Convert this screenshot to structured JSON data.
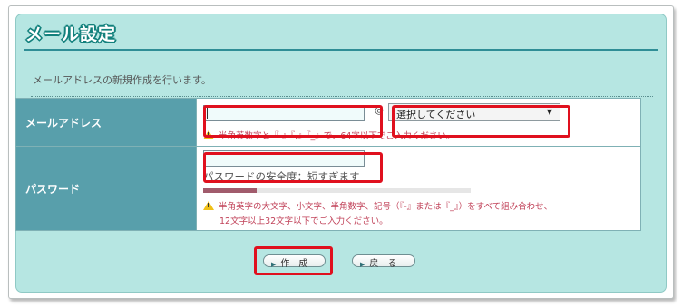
{
  "panel": {
    "title": "メール設定",
    "description": "メールアドレスの新規作成を行います。"
  },
  "form": {
    "email": {
      "label": "メールアドレス",
      "local_part_value": "",
      "at_sign": "@",
      "domain_select": {
        "selected": "選択してください"
      },
      "hint": "半角英数字と『-』『.』『_』で、64字以下でご入力ください。"
    },
    "password": {
      "label": "パスワード",
      "value": "",
      "strength_text": "パスワードの安全度：短すぎます",
      "strength_level": 0.2,
      "hint_line1": "半角英字の大文字、小文字、半角数字、記号（『-』または『_』）をすべて組み合わせ、",
      "hint_line2": "12文字以上32文字以下でご入力ください。"
    }
  },
  "buttons": {
    "create_label": "作　成",
    "back_label": "戻　る"
  },
  "colors": {
    "panel_bg": "#b6e6e2",
    "label_bg": "#589fab",
    "highlight": "#e0101e",
    "hint_text": "#c14259",
    "strength_bar": "#a15b6c"
  },
  "icons": {
    "warning": "warning-icon",
    "button_arrow": "triangle-right-icon"
  }
}
